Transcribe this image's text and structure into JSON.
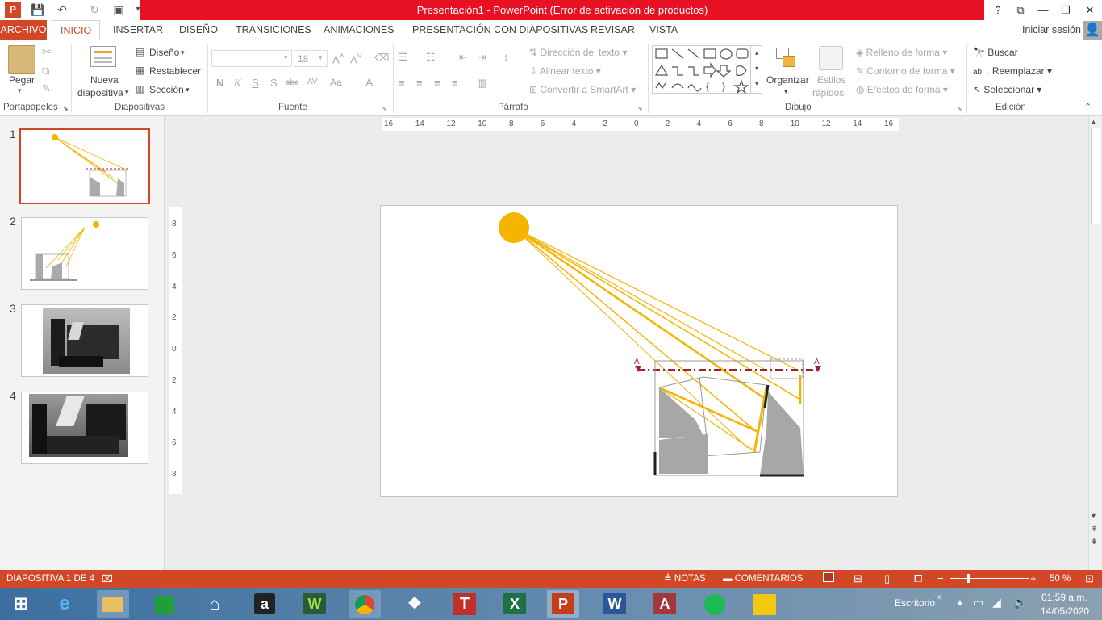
{
  "window": {
    "title": "Presentación1 -  PowerPoint (Error de activación de productos)"
  },
  "window_controls": {
    "help": "?",
    "restore_ribbon": "⧉",
    "minimize": "—",
    "maximize": "❐",
    "close": "✕"
  },
  "tabs": [
    "ARCHIVO",
    "INICIO",
    "INSERTAR",
    "DISEÑO",
    "TRANSICIONES",
    "ANIMACIONES",
    "PRESENTACIÓN CON DIAPOSITIVAS",
    "REVISAR",
    "VISTA"
  ],
  "active_tab": "INICIO",
  "signin": "Iniciar sesión",
  "ribbon": {
    "portapapeles": {
      "label": "Portapapeles",
      "paste": "Pegar"
    },
    "diapositivas": {
      "label": "Diapositivas",
      "new_slide_1": "Nueva",
      "new_slide_2": "diapositiva",
      "layout": "Diseño",
      "reset": "Restablecer",
      "section": "Sección"
    },
    "fuente": {
      "label": "Fuente",
      "font_name": "",
      "font_size": "18",
      "bold": "N",
      "italic": "K",
      "underline": "S",
      "shadow": "S",
      "strike": "abc",
      "spacing": "AV",
      "case": "Aa",
      "color": "A"
    },
    "parrafo": {
      "label": "Párrafo",
      "text_direction": "Dirección del texto",
      "align_text": "Alinear texto",
      "smartart": "Convertir a SmartArt"
    },
    "dibujo": {
      "label": "Dibujo",
      "arrange": "Organizar",
      "quick_styles_1": "Estilos",
      "quick_styles_2": "rápidos",
      "fill": "Relleno de forma",
      "outline": "Contorno de forma",
      "effects": "Efectos de forma"
    },
    "edicion": {
      "label": "Edición",
      "find": "Buscar",
      "replace": "Reemplazar",
      "select": "Seleccionar"
    }
  },
  "slides": [
    {
      "num": "1"
    },
    {
      "num": "2"
    },
    {
      "num": "3"
    },
    {
      "num": "4"
    }
  ],
  "hruler_ticks": [
    "16",
    "14",
    "12",
    "10",
    "8",
    "6",
    "4",
    "2",
    "0",
    "2",
    "4",
    "6",
    "8",
    "10",
    "12",
    "14",
    "16"
  ],
  "vruler_ticks": [
    "8",
    "6",
    "4",
    "2",
    "0",
    "2",
    "4",
    "6",
    "8"
  ],
  "slide_labels": {
    "marker_left": "A",
    "marker_right": "A"
  },
  "status": {
    "slide": "DIAPOSITIVA 1 DE 4",
    "notes": "NOTAS",
    "comments": "COMENTARIOS",
    "zoom": "50 %",
    "zoom_level_pct": 50
  },
  "taskbar": {
    "desktop": "Escritorio",
    "time": "01:59 a.m.",
    "date": "14/05/2020"
  },
  "colors": {
    "accent": "#d24726",
    "title_red": "#e81123",
    "sun": "#f4b400"
  }
}
